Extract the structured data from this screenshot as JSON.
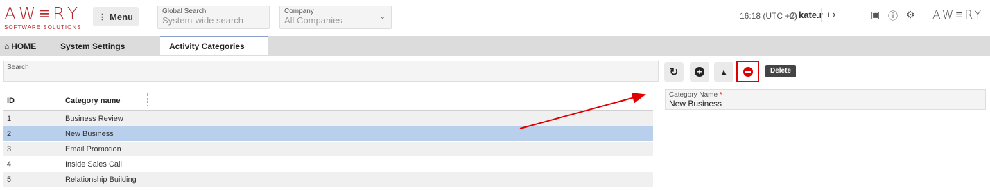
{
  "header": {
    "logo_main": "AW≡RY",
    "logo_sub": "SOFTWARE SOLUTIONS",
    "menu_label": "Menu",
    "global_search": {
      "label": "Global Search",
      "placeholder": "System-wide search"
    },
    "company": {
      "label": "Company",
      "value": "All Companies"
    },
    "time": "16:18 (UTC +2)",
    "user": "kate.r",
    "brand_right": "AW≡RY"
  },
  "tabs": [
    {
      "label": "HOME",
      "icon": "home-icon"
    },
    {
      "label": "System Settings"
    },
    {
      "label": "Activity Categories",
      "active": true
    }
  ],
  "search": {
    "label": "Search"
  },
  "table": {
    "columns": [
      "ID",
      "Category name"
    ],
    "rows": [
      {
        "id": "1",
        "name": "Business Review",
        "selected": false
      },
      {
        "id": "2",
        "name": "New Business",
        "selected": true
      },
      {
        "id": "3",
        "name": "Email Promotion",
        "selected": false
      },
      {
        "id": "4",
        "name": "Inside Sales Call",
        "selected": false
      },
      {
        "id": "5",
        "name": "Relationship Building",
        "selected": false
      }
    ]
  },
  "toolbar": {
    "refresh_icon": "refresh-icon",
    "add_icon": "plus-circle-icon",
    "clear_icon": "eraser-icon",
    "delete_icon": "minus-circle-icon",
    "tooltip": "Delete"
  },
  "detail": {
    "field_label": "Category Name",
    "required_mark": "*",
    "field_value": "New Business"
  },
  "colors": {
    "brand_red": "#b42a2a",
    "selected_row": "#b8d0ec",
    "highlight": "#e00000"
  }
}
